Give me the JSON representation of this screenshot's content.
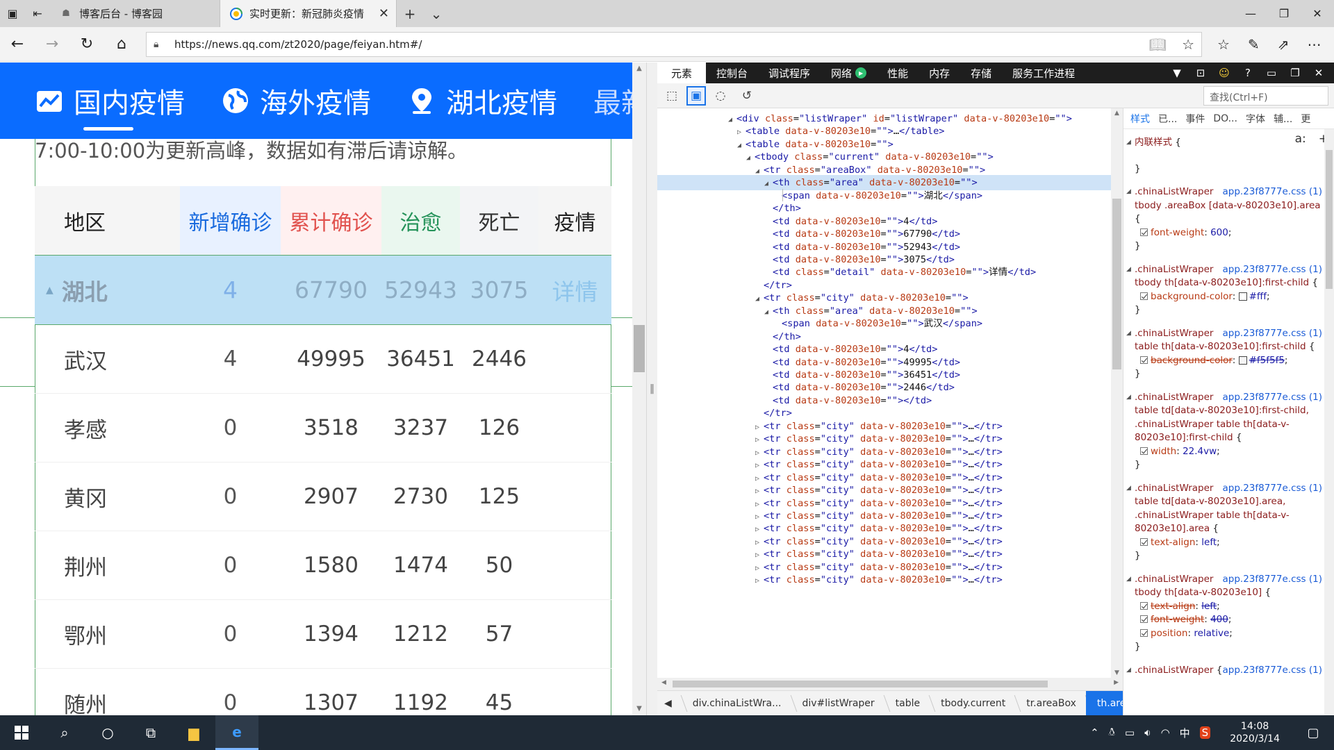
{
  "browser": {
    "tabs": [
      {
        "title": "博客后台 - 博客园",
        "icon": "cnblogs-icon"
      },
      {
        "title": "实时更新：新冠肺炎疫情",
        "icon": "qq-news-icon"
      }
    ],
    "url": "https://news.qq.com/zt2020/page/feiyan.htm#/"
  },
  "page": {
    "nav": [
      {
        "label": "国内疫情",
        "icon": "chart-icon"
      },
      {
        "label": "海外疫情",
        "icon": "globe-icon"
      },
      {
        "label": "湖北疫情",
        "icon": "location-pin-icon"
      },
      {
        "label": "最新"
      }
    ],
    "notice": "7:00-10:00为更新高峰，数据如有滞后请谅解。",
    "table": {
      "headers": [
        "地区",
        "新增确诊",
        "累计确诊",
        "治愈",
        "死亡",
        "疫情"
      ],
      "area": {
        "name": "湖北",
        "new": "4",
        "total": "67790",
        "cured": "52943",
        "dead": "3075",
        "detail": "详情"
      },
      "cities": [
        {
          "name": "武汉",
          "new": "4",
          "total": "49995",
          "cured": "36451",
          "dead": "2446"
        },
        {
          "name": "孝感",
          "new": "0",
          "total": "3518",
          "cured": "3237",
          "dead": "126"
        },
        {
          "name": "黄冈",
          "new": "0",
          "total": "2907",
          "cured": "2730",
          "dead": "125"
        },
        {
          "name": "荆州",
          "new": "0",
          "total": "1580",
          "cured": "1474",
          "dead": "50"
        },
        {
          "name": "鄂州",
          "new": "0",
          "total": "1394",
          "cured": "1212",
          "dead": "57"
        },
        {
          "name": "随州",
          "new": "0",
          "total": "1307",
          "cured": "1192",
          "dead": "45"
        }
      ]
    }
  },
  "devtools": {
    "tabs": [
      "元素",
      "控制台",
      "调试程序",
      "网络",
      "性能",
      "内存",
      "存储",
      "服务工作进程"
    ],
    "find_placeholder": "查找(Ctrl+F)",
    "breadcrumbs": [
      "div.chinaListWra...",
      "div#listWraper",
      "table",
      "tbody.current",
      "tr.areaBox",
      "th.area"
    ],
    "styles_tabs": [
      "样式",
      "已...",
      "事件",
      "DO...",
      "字体",
      "辅...",
      "更"
    ],
    "styles_tool": "a:",
    "inline_style": "内联样式",
    "rules": [
      {
        "selector": ".chinaListWraper tbody .areaBox [data-v-80203e10].area",
        "source": "app.23f8777e.css (1)",
        "props": [
          {
            "k": "font-weight",
            "v": "600"
          }
        ]
      },
      {
        "selector": ".chinaListWraper tbody th[data-v-80203e10]:first-child",
        "source": "app.23f8777e.css (1)",
        "props": [
          {
            "k": "background-color",
            "v": "#fff",
            "swatch": "#ffffff"
          }
        ]
      },
      {
        "selector": ".chinaListWraper table th[data-v-80203e10]:first-child",
        "source": "app.23f8777e.css (1)",
        "props": [
          {
            "k": "background-color",
            "v": "#f5f5f5",
            "swatch": "#f5f5f5",
            "strike": true
          }
        ]
      },
      {
        "selector": ".chinaListWraper table td[data-v-80203e10]:first-child, .chinaListWraper table th[data-v-80203e10]:first-child",
        "source": "app.23f8777e.css (1)",
        "props": [
          {
            "k": "width",
            "v": "22.4vw"
          }
        ]
      },
      {
        "selector": ".chinaListWraper table td[data-v-80203e10].area, .chinaListWraper table th[data-v-80203e10].area",
        "source": "app.23f8777e.css (1)",
        "props": [
          {
            "k": "text-align",
            "v": "left"
          }
        ]
      },
      {
        "selector": ".chinaListWraper tbody th[data-v-80203e10]",
        "source": "app.23f8777e.css (1)",
        "props": [
          {
            "k": "text-align",
            "v": "left",
            "strike": true
          },
          {
            "k": "font-weight",
            "v": "400",
            "strike": true
          },
          {
            "k": "position",
            "v": "relative"
          }
        ]
      },
      {
        "selector": ".chinaListWraper",
        "source": "app.23f8777e.css (1)",
        "props": []
      }
    ]
  },
  "taskbar": {
    "time": "14:08",
    "date": "2020/3/14",
    "ime": "中"
  }
}
